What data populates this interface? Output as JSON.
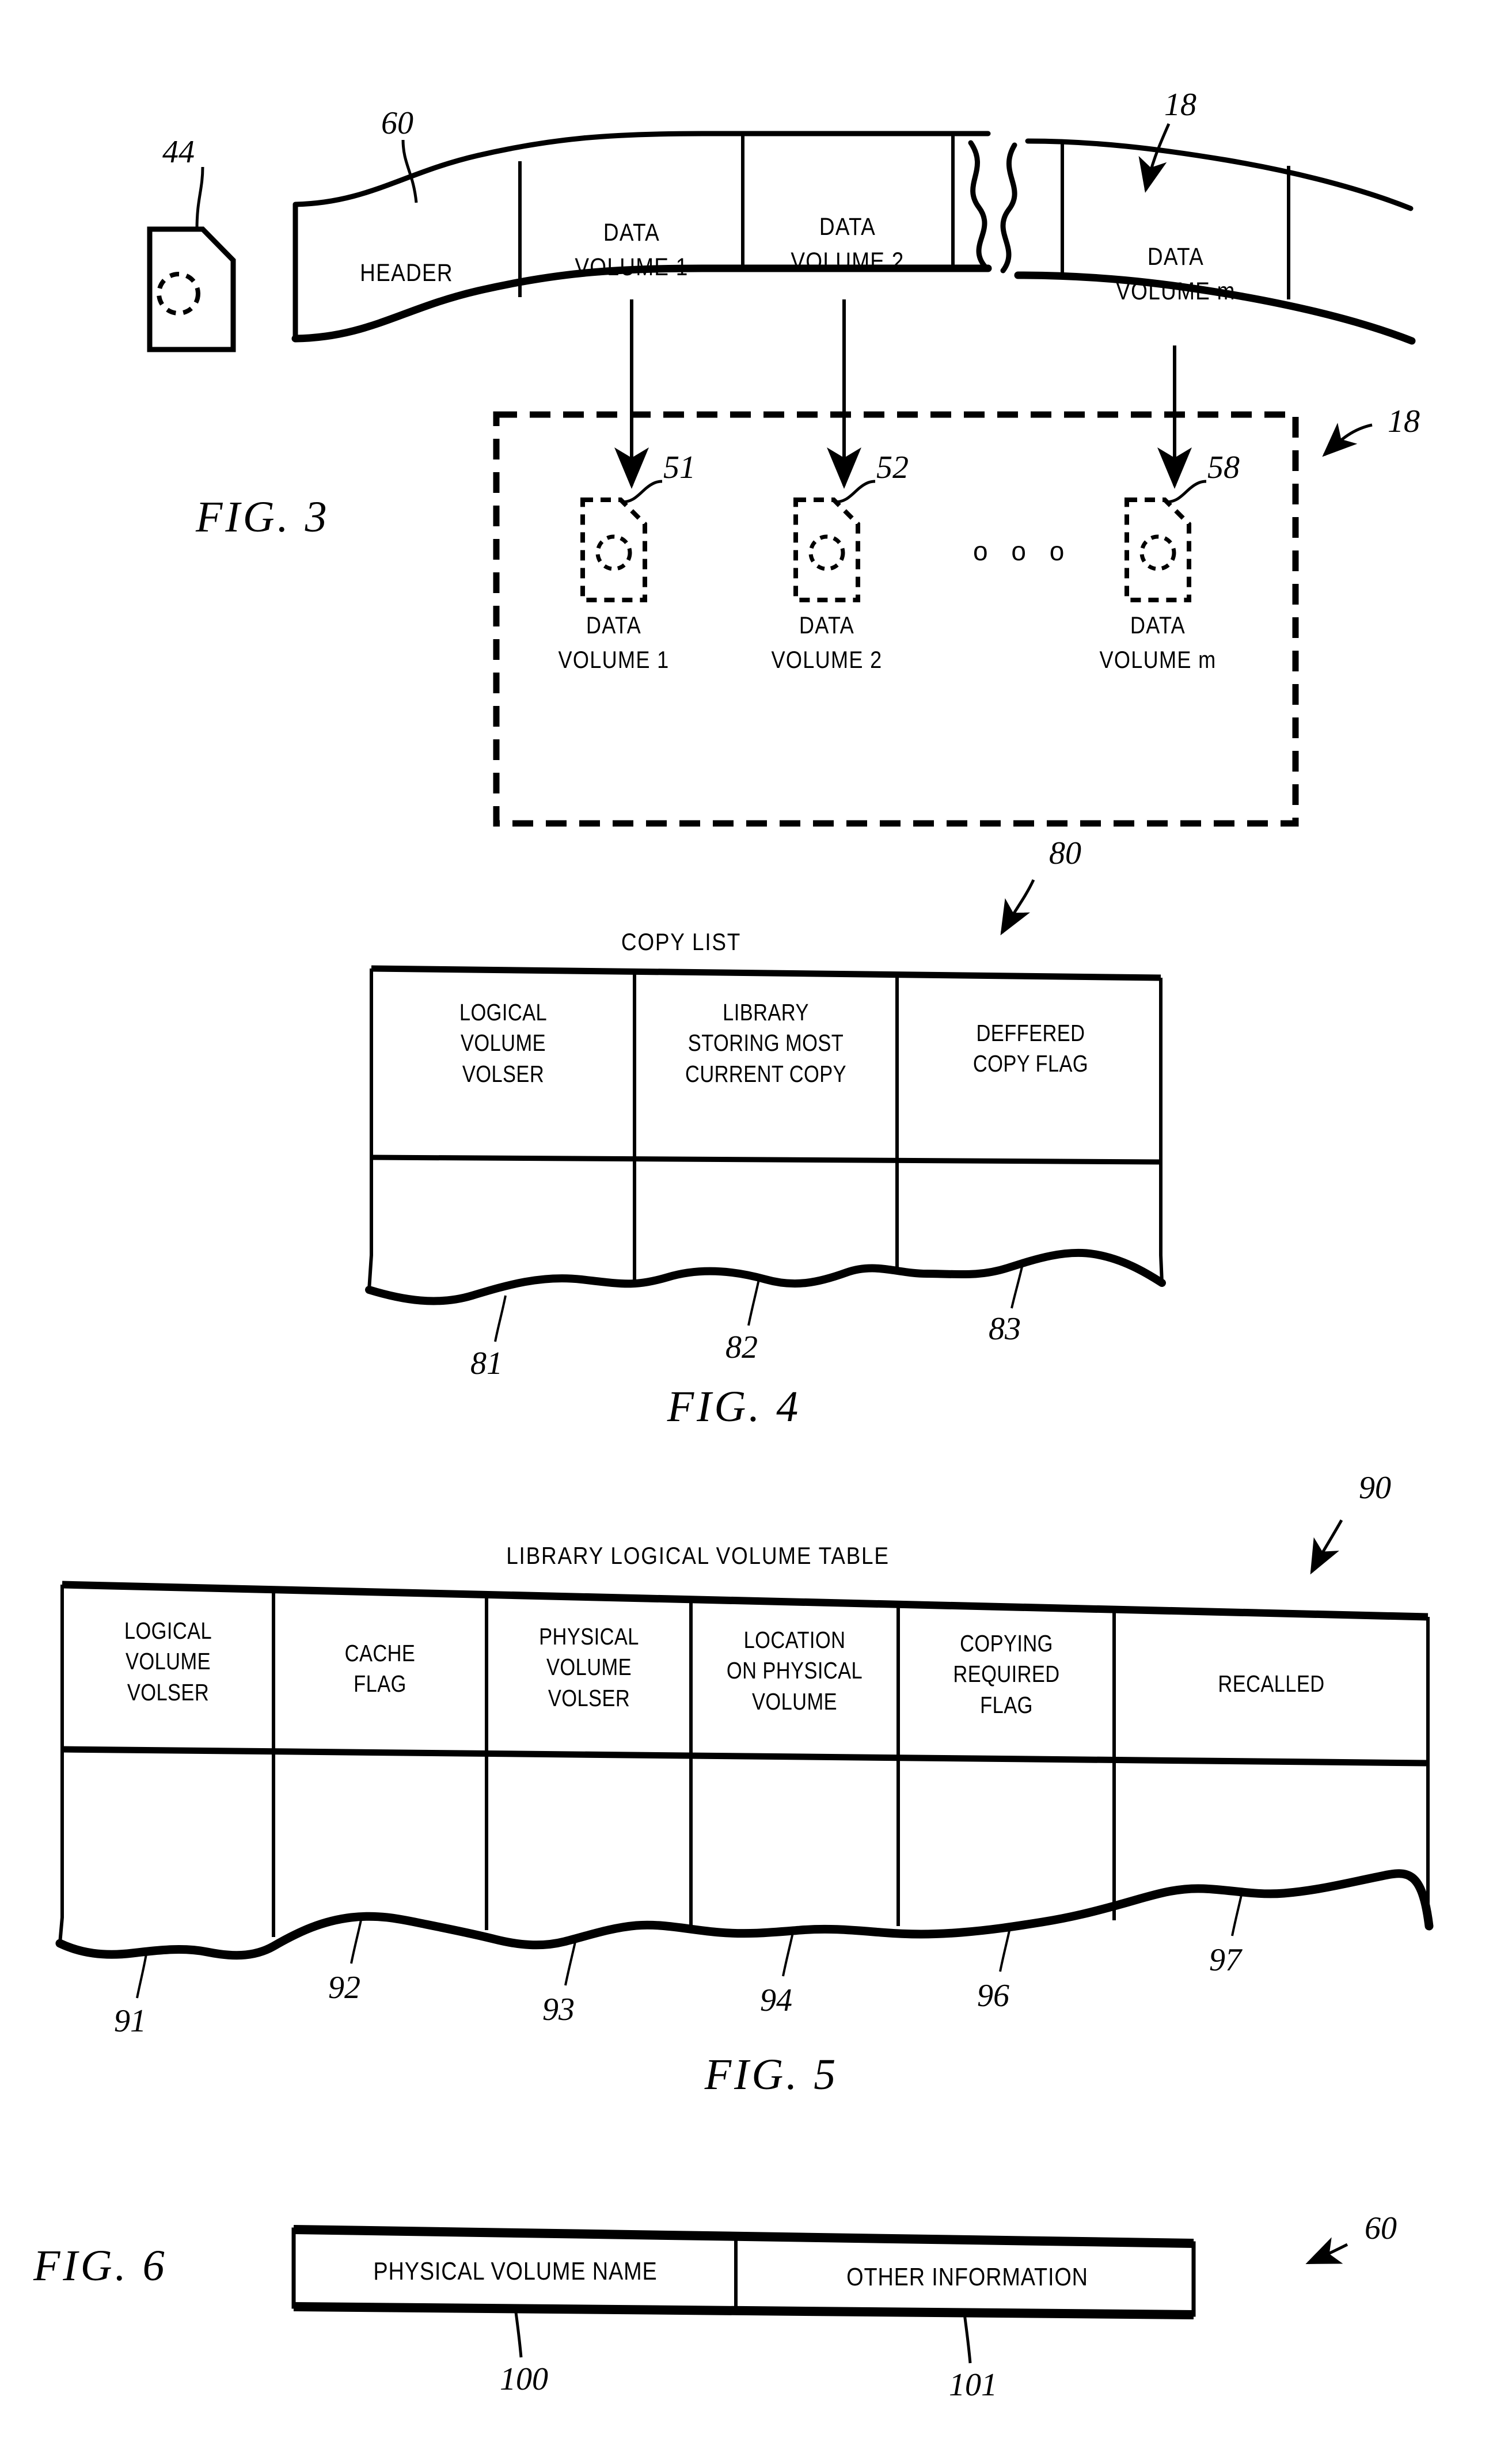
{
  "document": {
    "type": "patent-drawing-sheet",
    "figures": [
      "FIG. 3",
      "FIG. 4",
      "FIG. 5",
      "FIG. 6"
    ]
  },
  "fig3": {
    "label": "FIG.  3",
    "cartridge_ref": "44",
    "tape_ref": "60",
    "tape_arrow_ref": "18",
    "group_arrow_ref": "18",
    "tape_segments": [
      {
        "text": "HEADER"
      },
      {
        "line1": "DATA",
        "line2": "VOLUME 1"
      },
      {
        "line1": "DATA",
        "line2": "VOLUME 2"
      },
      {
        "line1": "DATA",
        "line2": "VOLUME m"
      }
    ],
    "logical_volumes": [
      {
        "ref": "51",
        "line1": "DATA",
        "line2": "VOLUME 1"
      },
      {
        "ref": "52",
        "line1": "DATA",
        "line2": "VOLUME 2"
      },
      {
        "ref": "58",
        "line1": "DATA",
        "line2": "VOLUME m"
      }
    ],
    "ellipsis": "o o o"
  },
  "fig4": {
    "label": "FIG.  4",
    "table_title": "COPY LIST",
    "table_ref": "80",
    "columns": [
      {
        "ref": "81",
        "lines": [
          "LOGICAL",
          "VOLUME",
          "VOLSER"
        ]
      },
      {
        "ref": "82",
        "lines": [
          "LIBRARY",
          "STORING MOST",
          "CURRENT COPY"
        ]
      },
      {
        "ref": "83",
        "lines": [
          "DEFFERED",
          "COPY FLAG"
        ]
      }
    ]
  },
  "fig5": {
    "label": "FIG.  5",
    "table_title": "LIBRARY LOGICAL VOLUME TABLE",
    "table_ref": "90",
    "columns": [
      {
        "ref": "91",
        "lines": [
          "LOGICAL",
          "VOLUME",
          "VOLSER"
        ]
      },
      {
        "ref": "92",
        "lines": [
          "CACHE",
          "FLAG"
        ]
      },
      {
        "ref": "93",
        "lines": [
          "PHYSICAL",
          "VOLUME",
          "VOLSER"
        ]
      },
      {
        "ref": "94",
        "lines": [
          "LOCATION",
          "ON PHYSICAL",
          "VOLUME"
        ]
      },
      {
        "ref": "96",
        "lines": [
          "COPYING",
          "REQUIRED",
          "FLAG"
        ]
      },
      {
        "ref": "97",
        "lines": [
          "RECALLED"
        ]
      }
    ]
  },
  "fig6": {
    "label": "FIG.  6",
    "record_ref": "60",
    "fields": [
      {
        "ref": "100",
        "text": "PHYSICAL VOLUME NAME"
      },
      {
        "ref": "101",
        "text": "OTHER INFORMATION"
      }
    ]
  },
  "colors": {
    "ink": "#000000",
    "paper": "#ffffff"
  }
}
